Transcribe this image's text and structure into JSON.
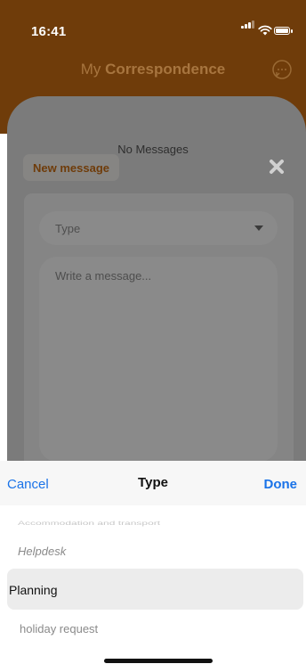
{
  "status_bar": {
    "time": "16:41"
  },
  "header": {
    "title_prefix": "My",
    "title_main": "Correspondence"
  },
  "messages": {
    "empty_text": "No Messages"
  },
  "compose": {
    "new_message_label": "New message",
    "type_placeholder": "Type",
    "message_placeholder": "Write a message..."
  },
  "picker_sheet": {
    "cancel_label": "Cancel",
    "title": "Type",
    "done_label": "Done",
    "options": [
      {
        "label": "Accommodation and transport"
      },
      {
        "label": "Helpdesk"
      },
      {
        "label": "Planning"
      },
      {
        "label": "holiday request"
      }
    ],
    "selected": "Planning"
  },
  "colors": {
    "brand_brown": "#6f3c0a",
    "ios_blue": "#1a73e8",
    "overlay_gray": "#7b7b7b"
  }
}
